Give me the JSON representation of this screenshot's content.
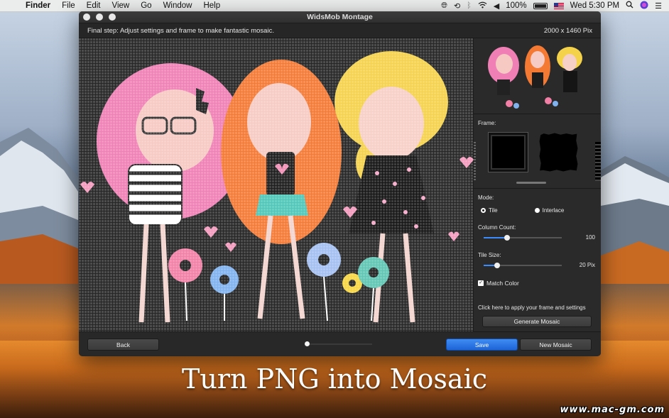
{
  "menubar": {
    "apple_icon": "apple-icon",
    "items": [
      "Finder",
      "File",
      "Edit",
      "View",
      "Go",
      "Window",
      "Help"
    ],
    "battery_percent": "100%",
    "clock": "Wed 5:30 PM",
    "status_icons": [
      "globe-icon",
      "time-machine-icon",
      "bluetooth-icon",
      "wifi-icon",
      "volume-icon",
      "battery-icon",
      "flag-icon",
      "search-icon",
      "siri-icon",
      "menu-list-icon"
    ]
  },
  "window": {
    "title": "WidsMob Montage",
    "instruction": "Final step: Adjust settings and frame to make fantastic mosaic.",
    "dimensions": "2000 x 1460 Pix"
  },
  "sidebar": {
    "frame_label": "Frame:",
    "mode_label": "Mode:",
    "modes": [
      "Tile",
      "Interlace"
    ],
    "selected_mode": "Tile",
    "column_count_label": "Column Count:",
    "column_count_value": "100",
    "column_count_fraction": 0.3,
    "tile_size_label": "Tile Size:",
    "tile_size_value": "20 Pix",
    "tile_size_fraction": 0.17,
    "match_color_label": "Match Color",
    "match_color_checked": true,
    "apply_hint": "Click here to apply your frame and settings",
    "generate_button": "Generate Mosaic"
  },
  "bottombar": {
    "back_button": "Back",
    "save_button": "Save",
    "new_mosaic_button": "New Mosaic",
    "step_progress": 0
  },
  "overlay": {
    "caption": "Turn PNG into Mosaic",
    "watermark": "www.mac-gm.com"
  },
  "colors": {
    "accent": "#2a74e6",
    "window_bg": "#262626",
    "pink_hair": "#f07eb3",
    "orange_hair": "#f4762f",
    "yellow_hair": "#f5d447"
  }
}
